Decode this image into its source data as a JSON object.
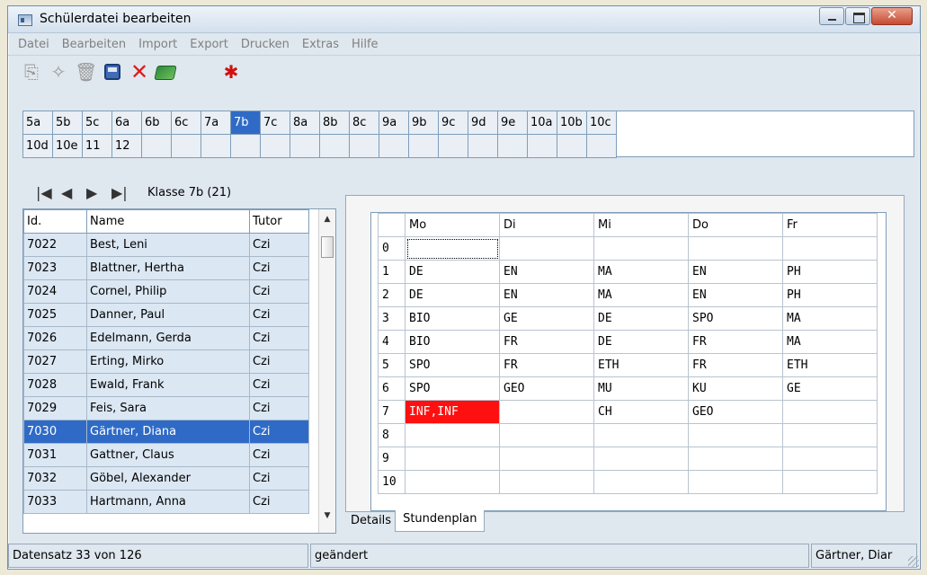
{
  "window": {
    "title": "Schülerdatei bearbeiten"
  },
  "menu": [
    "Datei",
    "Bearbeiten",
    "Import",
    "Export",
    "Drucken",
    "Extras",
    "Hilfe"
  ],
  "classes": {
    "row1": [
      "5a",
      "5b",
      "5c",
      "6a",
      "6b",
      "6c",
      "7a",
      "7b",
      "7c",
      "8a",
      "8b",
      "8c",
      "9a",
      "9b",
      "9c",
      "9d",
      "9e",
      "10a",
      "10b",
      "10c"
    ],
    "row2": [
      "10d",
      "10e",
      "11",
      "12",
      "",
      "",
      "",
      "",
      "",
      "",
      "",
      "",
      "",
      "",
      "",
      "",
      "",
      "",
      "",
      ""
    ],
    "selected": "7b"
  },
  "nav": {
    "klasse": "Klasse 7b (21)"
  },
  "students": {
    "headers": [
      "Id.",
      "Name",
      "Tutor"
    ],
    "rows": [
      [
        "7022",
        "Best, Leni",
        "Czi"
      ],
      [
        "7023",
        "Blattner, Hertha",
        "Czi"
      ],
      [
        "7024",
        "Cornel, Philip",
        "Czi"
      ],
      [
        "7025",
        "Danner, Paul",
        "Czi"
      ],
      [
        "7026",
        "Edelmann, Gerda",
        "Czi"
      ],
      [
        "7027",
        "Erting, Mirko",
        "Czi"
      ],
      [
        "7028",
        "Ewald, Frank",
        "Czi"
      ],
      [
        "7029",
        "Feis, Sara",
        "Czi"
      ],
      [
        "7030",
        "Gärtner, Diana",
        "Czi"
      ],
      [
        "7031",
        "Gattner, Claus",
        "Czi"
      ],
      [
        "7032",
        "Göbel, Alexander",
        "Czi"
      ],
      [
        "7033",
        "Hartmann, Anna",
        "Czi"
      ]
    ],
    "selected_id": "7030"
  },
  "timetable": {
    "days": [
      "Mo",
      "Di",
      "Mi",
      "Do",
      "Fr"
    ],
    "rows": [
      {
        "n": "0",
        "cells": [
          "",
          "",
          "",
          "",
          ""
        ]
      },
      {
        "n": "1",
        "cells": [
          "DE",
          "EN",
          "MA",
          "EN",
          "PH"
        ]
      },
      {
        "n": "2",
        "cells": [
          "DE",
          "EN",
          "MA",
          "EN",
          "PH"
        ]
      },
      {
        "n": "3",
        "cells": [
          "BIO",
          "GE",
          "DE",
          "SPO",
          "MA"
        ]
      },
      {
        "n": "4",
        "cells": [
          "BIO",
          "FR",
          "DE",
          "FR",
          "MA"
        ]
      },
      {
        "n": "5",
        "cells": [
          "SPO",
          "FR",
          "ETH",
          "FR",
          "ETH"
        ]
      },
      {
        "n": "6",
        "cells": [
          "SPO",
          "GEO",
          "MU",
          "KU",
          "GE"
        ]
      },
      {
        "n": "7",
        "cells": [
          "INF,INF",
          "",
          "CH",
          "GEO",
          ""
        ]
      },
      {
        "n": "8",
        "cells": [
          "",
          "",
          "",
          "",
          ""
        ]
      },
      {
        "n": "9",
        "cells": [
          "",
          "",
          "",
          "",
          ""
        ]
      },
      {
        "n": "10",
        "cells": [
          "",
          "",
          "",
          "",
          ""
        ]
      }
    ],
    "highlight_color": "#ff1010"
  },
  "tabs": [
    "Details",
    "Stundenplan"
  ],
  "active_tab": "Stundenplan",
  "status": {
    "record": "Datensatz 33 von 126",
    "state": "geändert",
    "name": "Gärtner, Diar"
  },
  "colors": {
    "selection": "#2f6bc6",
    "row_bg": "#dbe7f3"
  }
}
